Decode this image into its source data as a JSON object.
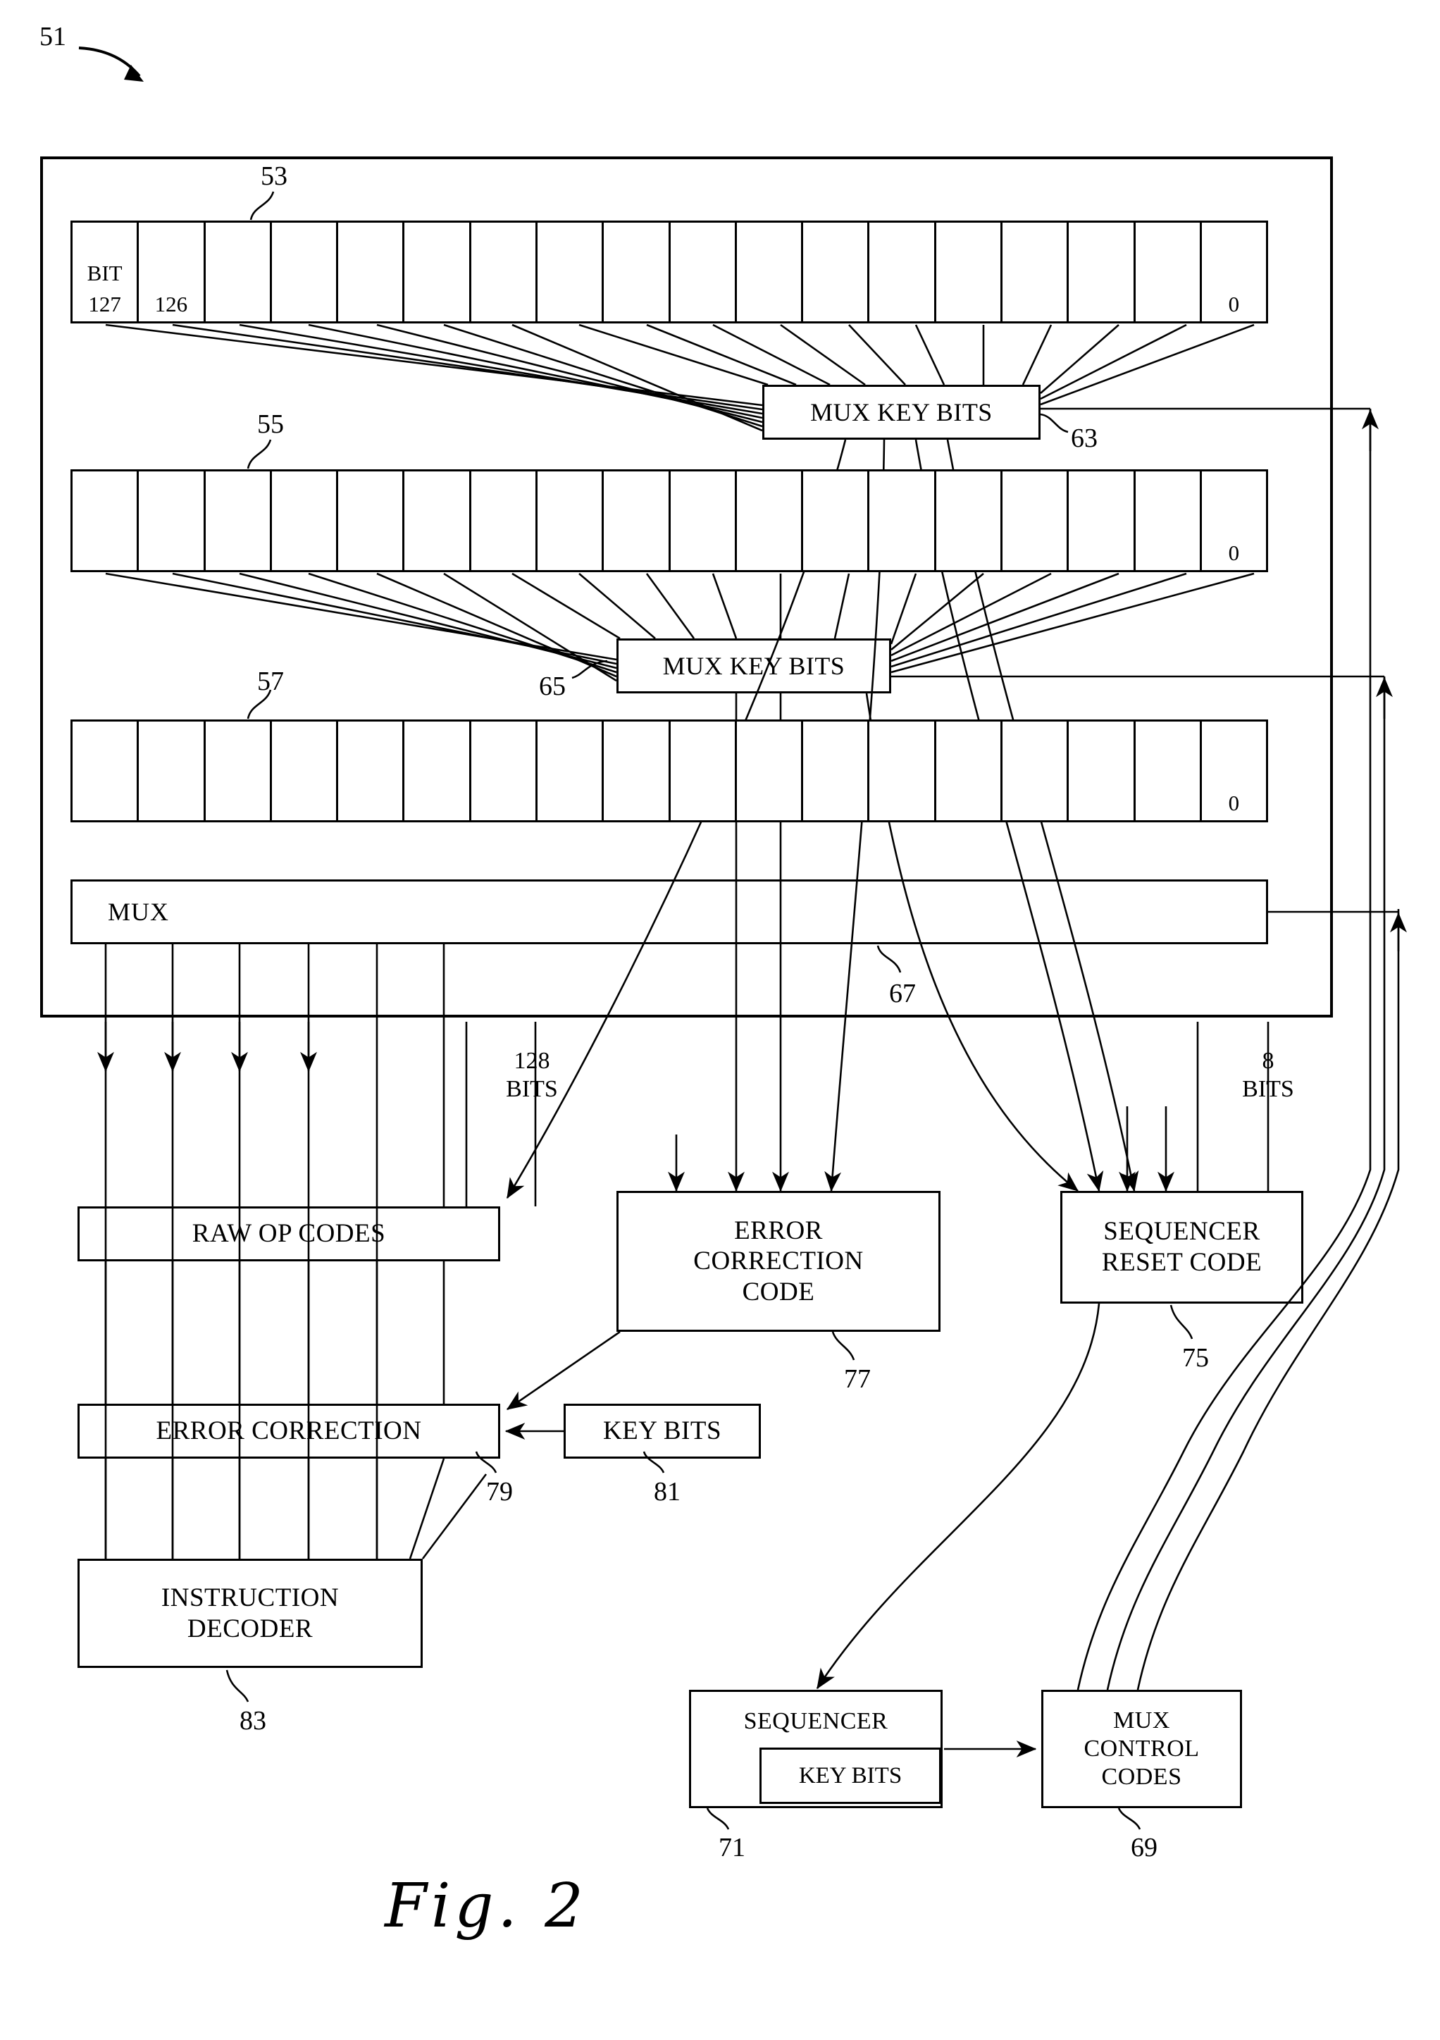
{
  "figure": {
    "caption_label": "Fig.",
    "caption_number": "2",
    "system_ref": "51"
  },
  "registers": [
    {
      "ref": "53",
      "first_cell_word": "BIT",
      "first_cell_bit": "127",
      "second_cell_bit": "126",
      "last_cell_bit": "0",
      "cells": 18
    },
    {
      "ref": "55",
      "first_cell_word": "",
      "first_cell_bit": "",
      "second_cell_bit": "",
      "last_cell_bit": "0",
      "cells": 18
    },
    {
      "ref": "57",
      "first_cell_word": "",
      "first_cell_bit": "",
      "second_cell_bit": "",
      "last_cell_bit": "0",
      "cells": 18
    }
  ],
  "mux_bar": {
    "label": "MUX",
    "ref": "67"
  },
  "mux_key_bits_1": {
    "label": "MUX KEY BITS",
    "ref": "63"
  },
  "mux_key_bits_2": {
    "label": "MUX KEY BITS",
    "ref": "65"
  },
  "bus_labels": {
    "left": {
      "line1": "128",
      "line2": "BITS"
    },
    "right": {
      "line1": "8",
      "line2": "BITS"
    }
  },
  "blocks": {
    "raw_op_codes": {
      "label": "RAW OP CODES"
    },
    "error_correction_code": {
      "line1": "ERROR",
      "line2": "CORRECTION",
      "line3": "CODE",
      "ref": "77"
    },
    "sequencer_reset_code": {
      "line1": "SEQUENCER",
      "line2": "RESET CODE",
      "ref": "75"
    },
    "error_correction": {
      "label": "ERROR CORRECTION",
      "ref": "79"
    },
    "key_bits": {
      "label": "KEY BITS",
      "ref": "81"
    },
    "instruction_decoder": {
      "line1": "INSTRUCTION",
      "line2": "DECODER",
      "ref": "83"
    },
    "sequencer": {
      "label": "SEQUENCER",
      "sub_label": "KEY BITS",
      "ref": "71"
    },
    "mux_control_codes": {
      "line1": "MUX",
      "line2": "CONTROL",
      "line3": "CODES",
      "ref": "69"
    }
  },
  "colors": {
    "ink": "#000000",
    "paper": "#ffffff"
  }
}
